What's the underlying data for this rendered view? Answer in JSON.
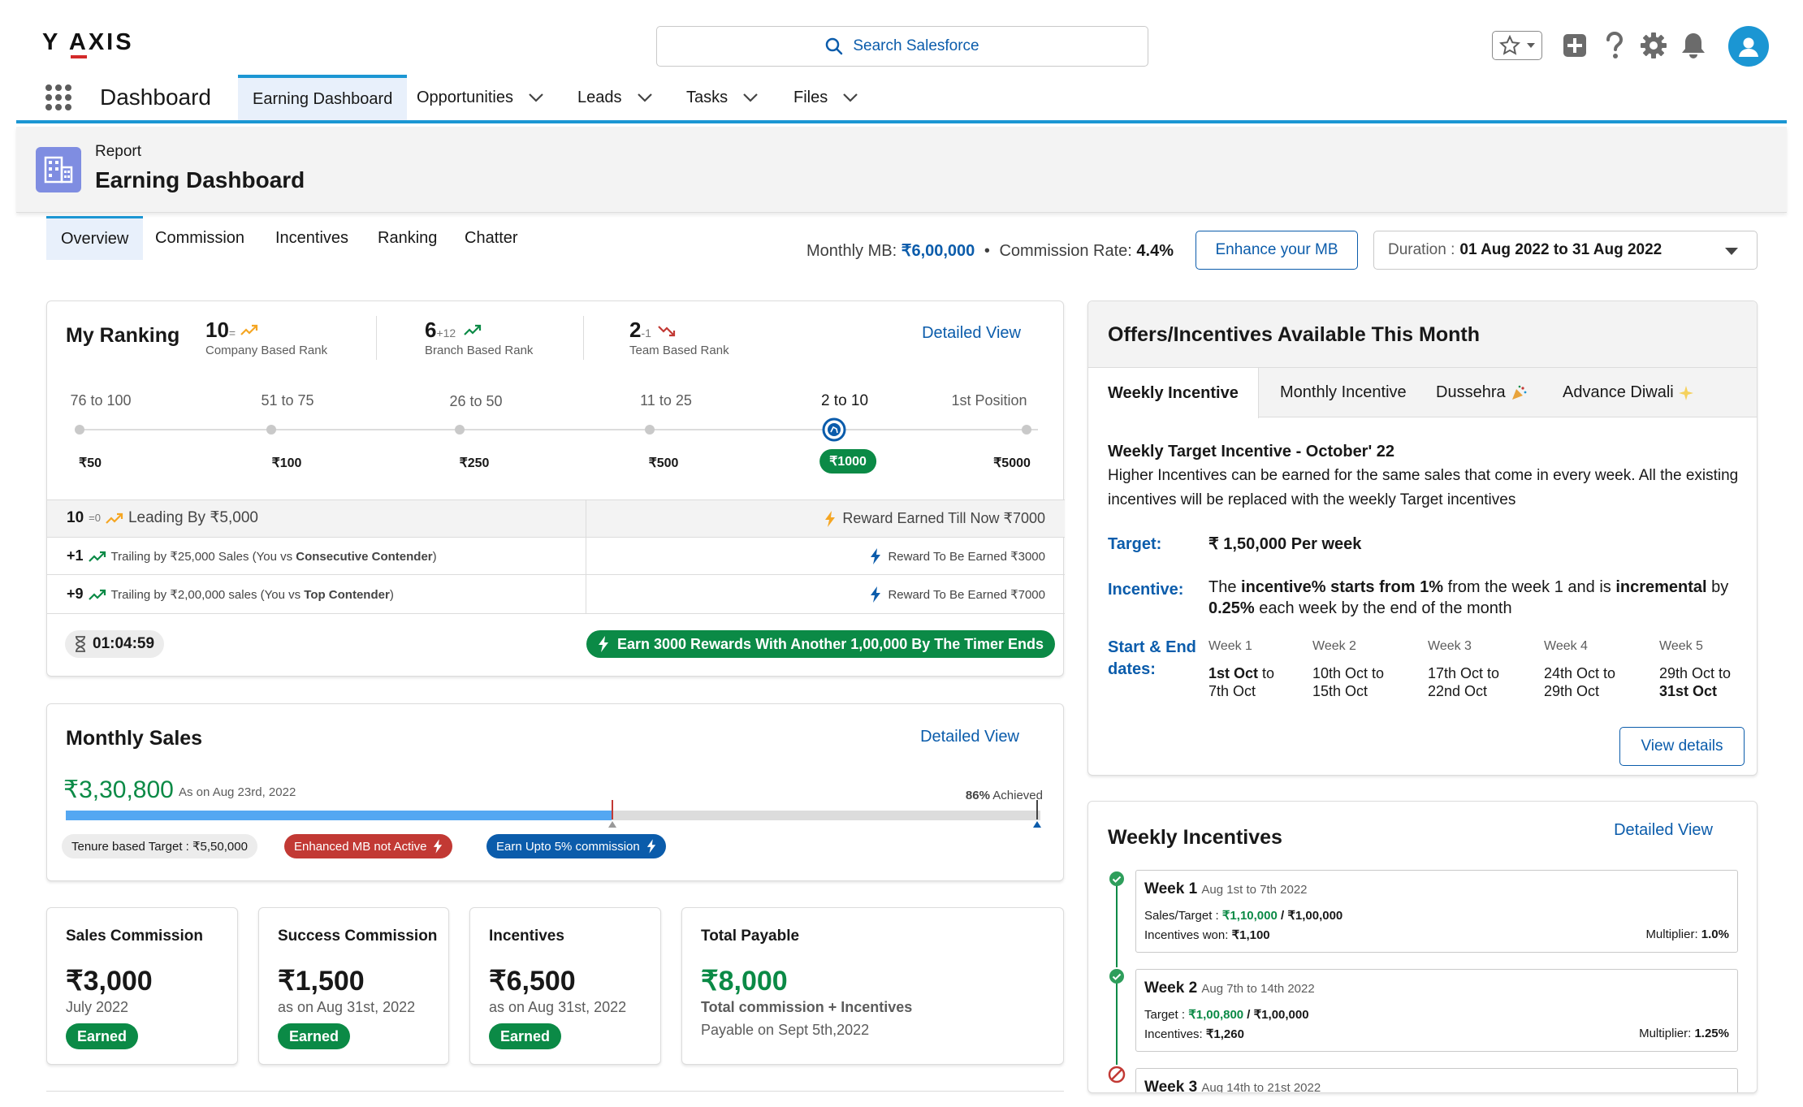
{
  "brand": {
    "logo": "YAXIS"
  },
  "search": {
    "label": "Search Salesforce"
  },
  "nav": {
    "app_name": "Dashboard",
    "tabs": [
      {
        "label": "Earning Dashboard",
        "active": true
      },
      {
        "label": "Opportunities"
      },
      {
        "label": "Leads"
      },
      {
        "label": "Tasks"
      },
      {
        "label": "Files"
      }
    ]
  },
  "page_header": {
    "type": "Report",
    "title": "Earning Dashboard"
  },
  "sub_tabs": [
    "Overview",
    "Commission",
    "Incentives",
    "Ranking",
    "Chatter"
  ],
  "summary": {
    "mb_label": "Monthly MB:",
    "mb_value": "₹6,00,000",
    "bullet": "•",
    "rate_label": "Commission Rate:",
    "rate_value": "4.4%",
    "enhance_button": "Enhance your MB",
    "duration_label": "Duration :",
    "duration_value": "01 Aug 2022 to 31 Aug 2022"
  },
  "ranking": {
    "title": "My Ranking",
    "detailed_view": "Detailed View",
    "company": {
      "rank": "10",
      "change": "=",
      "caption": "Company Based Rank"
    },
    "branch": {
      "rank": "6",
      "change": "+12",
      "caption": "Branch Based Rank"
    },
    "team": {
      "rank": "2",
      "change": "-1",
      "caption": "Team Based Rank"
    },
    "ranges": [
      "76 to 100",
      "51 to 75",
      "26 to 50",
      "11 to 25",
      "2 to 10",
      "1st Position"
    ],
    "rewards": [
      "₹50",
      "₹100",
      "₹250",
      "₹500",
      "₹1000",
      "₹5000"
    ],
    "active_index": 4,
    "rows": [
      {
        "rank": "10",
        "delta": "=0",
        "text": "Leading By ₹5,000",
        "right": "Reward Earned Till Now ₹7000"
      },
      {
        "rank": "+1",
        "text_a": "Trailing by ₹25,000 Sales (You vs ",
        "text_b": "Consecutive Contender",
        "text_c": ")",
        "right": "Reward To Be Earned ₹3000"
      },
      {
        "rank": "+9",
        "text_a": "Trailing by ₹2,00,000 sales (You vs ",
        "text_b": "Top Contender",
        "text_c": ")",
        "right": "Reward To Be Earned ₹7000"
      }
    ],
    "timer": "01:04:59",
    "earn_message": "Earn 3000 Rewards With Another 1,00,000 By The Timer Ends"
  },
  "monthly_sales": {
    "title": "Monthly Sales",
    "detailed_view": "Detailed View",
    "amount": "₹3,30,800",
    "as_of": "As on Aug 23rd, 2022",
    "achieved_pct": "86%",
    "achieved_label": "Achieved",
    "progress_fraction": 0.56,
    "pill_target": "Tenure based Target : ₹5,50,000",
    "pill_mb": "Enhanced MB not Active",
    "pill_commission": "Earn Upto 5% commission"
  },
  "stats": [
    {
      "title": "Sales Commission",
      "value": "₹3,000",
      "sub": "July 2022",
      "badge": "Earned"
    },
    {
      "title": "Success Commission",
      "value": "₹1,500",
      "sub": "as on Aug 31st, 2022",
      "badge": "Earned"
    },
    {
      "title": "Incentives",
      "value": "₹6,500",
      "sub": "as on Aug 31st, 2022",
      "badge": "Earned"
    },
    {
      "title": "Total Payable",
      "value": "₹8,000",
      "sub": "Total commission + Incentives",
      "sub2": "Payable on Sept 5th,2022"
    }
  ],
  "offers": {
    "title": "Offers/Incentives Available This Month",
    "tabs": [
      "Weekly Incentive",
      "Monthly Incentive",
      "Dussehra",
      "Advance Diwali"
    ],
    "heading": "Weekly Target Incentive - October' 22",
    "description": "Higher Incentives can be earned for the same sales that come in every week. All the existing incentives will be replaced with the weekly Target incentives",
    "target_label": "Target:",
    "target_value": "₹ 1,50,000 Per week",
    "incentive_label": "Incentive:",
    "incentive_1": "The ",
    "incentive_2": "incentive% starts from 1%",
    "incentive_3": " from the week 1 and is ",
    "incentive_4": "incremental",
    "incentive_5": " by ",
    "incentive_6": "0.25%",
    "incentive_7": " each week by the end of the month",
    "dates_label": "Start & End dates:",
    "weeks": [
      {
        "name": "Week 1",
        "start": "1st Oct",
        "to": " to",
        "end": "7th Oct",
        "bold_start": true
      },
      {
        "name": "Week 2",
        "start": "10th Oct",
        "to": " to",
        "end": "15th Oct"
      },
      {
        "name": "Week 3",
        "start": "17th Oct",
        "to": " to",
        "end": "22nd Oct"
      },
      {
        "name": "Week 4",
        "start": "24th Oct",
        "to": " to",
        "end": "29th Oct"
      },
      {
        "name": "Week 5",
        "start": "29th Oct",
        "to": " to",
        "end": "31st Oct",
        "bold_end": true
      }
    ],
    "view_details": "View details"
  },
  "weekly_incentives": {
    "title": "Weekly Incentives",
    "detailed_view": "Detailed View",
    "items": [
      {
        "week": "Week 1",
        "range": "Aug 1st to 7th 2022",
        "l1_label": "Sales/Target : ",
        "l1_value": "₹1,10,000",
        "l1_rest": " / ₹1,00,000",
        "l2_label": "Incentives won: ",
        "l2_value": "₹1,100",
        "mult_label": "Multiplier: ",
        "mult_value": "1.0%",
        "status": "done"
      },
      {
        "week": "Week 2",
        "range": "Aug 7th to 14th 2022",
        "l1_label": "Target : ",
        "l1_value": "₹1,00,800",
        "l1_rest": " / ₹1,00,000",
        "l2_label": "Incentives: ",
        "l2_value": "₹1,260",
        "mult_label": "Multiplier: ",
        "mult_value": "1.25%",
        "status": "done"
      },
      {
        "week": "Week 3",
        "range": "Aug 14th to 21st 2022",
        "status": "missed"
      }
    ]
  },
  "colors": {
    "brand_blue": "#0b5cab",
    "accent_blue": "#1b96d3",
    "success_green": "#0b8a46",
    "danger_red": "#c23934"
  }
}
